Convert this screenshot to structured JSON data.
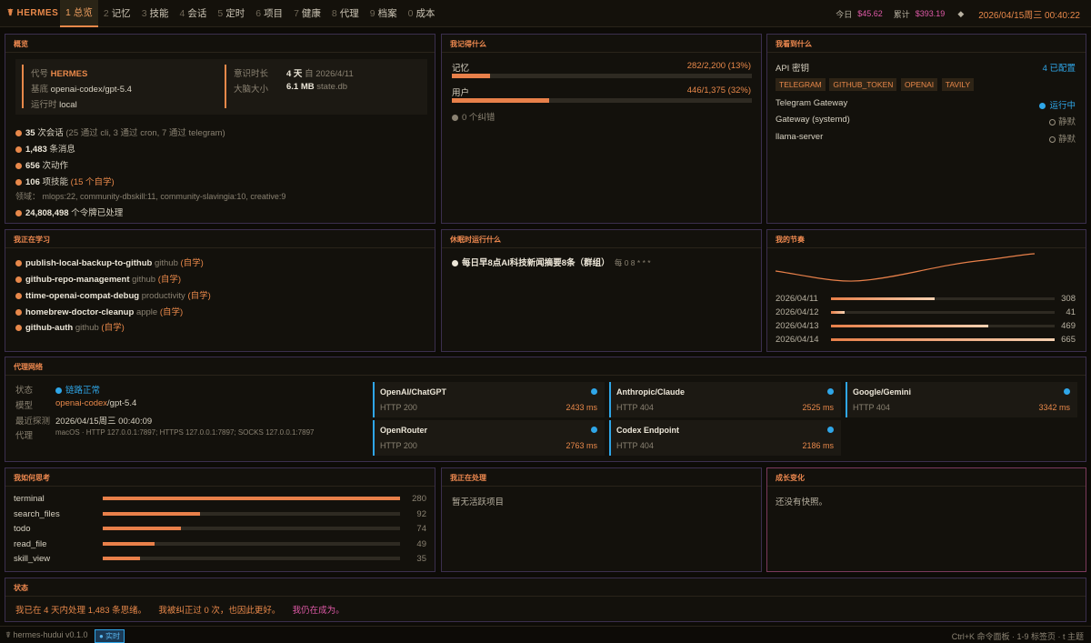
{
  "topbar": {
    "brand": "☤ HERMES",
    "tabs": [
      {
        "n": "1",
        "label": "总览"
      },
      {
        "n": "2",
        "label": "记忆"
      },
      {
        "n": "3",
        "label": "技能"
      },
      {
        "n": "4",
        "label": "会话"
      },
      {
        "n": "5",
        "label": "定时"
      },
      {
        "n": "6",
        "label": "项目"
      },
      {
        "n": "7",
        "label": "健康"
      },
      {
        "n": "8",
        "label": "代理"
      },
      {
        "n": "9",
        "label": "档案"
      },
      {
        "n": "0",
        "label": "成本"
      }
    ],
    "today_label": "今日",
    "today_value": "$45.62",
    "total_label": "累计",
    "total_value": "$393.19",
    "sep": "◆",
    "datetime": "2026/04/15周三 00:40:22"
  },
  "overview": {
    "title": "概览",
    "codename_label": "代号",
    "codename": "HERMES",
    "base_label": "基底",
    "base": "openai-codex/gpt-5.4",
    "runtime_label": "运行时",
    "runtime": "local",
    "awareness_label": "意识时长",
    "awareness_value": "4 天",
    "awareness_since": "自 2026/4/11",
    "brain_label": "大脑大小",
    "brain_value": "6.1 MB",
    "brain_file": "state.db",
    "sessions_value": "35",
    "sessions_text": "次会话",
    "sessions_detail": "(25 通过 cli, 3 通过 cron, 7 通过 telegram)",
    "messages_value": "1,483",
    "messages_text": "条消息",
    "actions_value": "656",
    "actions_text": "次动作",
    "skills_value": "106",
    "skills_text": "项技能",
    "skills_self": "(15 个自学)",
    "domains_text": "领域： mlops:22, community-dbskill:11, community-slavingia:10, creative:9",
    "tokens_value": "24,808,498",
    "tokens_text": "个令牌已处理"
  },
  "memory": {
    "title": "我记得什么",
    "mem_label": "记忆",
    "mem_value": "282/2,200 (13%)",
    "mem_fraction": 0.128,
    "user_label": "用户",
    "user_value": "446/1,375 (32%)",
    "user_fraction": 0.324,
    "corrections": "0 个纠错"
  },
  "sees": {
    "title": "我看到什么",
    "api_label": "API 密钥",
    "api_value": "4 已配置",
    "tags": [
      "TELEGRAM",
      "GITHUB_TOKEN",
      "OPENAI",
      "TAVILY"
    ],
    "services": [
      {
        "name": "Telegram Gateway",
        "status": "运行中",
        "on": true
      },
      {
        "name": "Gateway (systemd)",
        "status": "静默",
        "on": false
      },
      {
        "name": "llama-server",
        "status": "静默",
        "on": false
      }
    ]
  },
  "learning": {
    "title": "我正在学习",
    "items": [
      {
        "name": "publish-local-backup-to-github",
        "cat": "github",
        "tag": "(自学)"
      },
      {
        "name": "github-repo-management",
        "cat": "github",
        "tag": "(自学)"
      },
      {
        "name": "ttime-openai-compat-debug",
        "cat": "productivity",
        "tag": "(自学)"
      },
      {
        "name": "homebrew-doctor-cleanup",
        "cat": "apple",
        "tag": "(自学)"
      },
      {
        "name": "github-auth",
        "cat": "github",
        "tag": "(自学)"
      }
    ]
  },
  "sleep": {
    "title": "休眠时运行什么",
    "job": "每日早8点AI科技新闻摘要8条（群组）",
    "cron": "每 0 8 * * *"
  },
  "rhythm": {
    "title": "我的节奏",
    "days": [
      {
        "date": "2026/04/11",
        "value": 308
      },
      {
        "date": "2026/04/12",
        "value": 41
      },
      {
        "date": "2026/04/13",
        "value": 469
      },
      {
        "date": "2026/04/14",
        "value": 665
      }
    ]
  },
  "proxy": {
    "title": "代理网络",
    "status_label": "状态",
    "status_value": "链路正常",
    "model_label": "模型",
    "model_value_a": "openai-codex",
    "model_value_b": "/gpt-5.4",
    "probe_label": "最近探测",
    "probe_value": "2026/04/15周三 00:40:09",
    "proxy_label": "代理",
    "proxy_value": "macOS · HTTP 127.0.0.1:7897; HTTPS 127.0.0.1:7897; SOCKS 127.0.0.1:7897",
    "endpoints": [
      {
        "name": "OpenAI/ChatGPT",
        "status": "HTTP 200",
        "latency": "2433 ms"
      },
      {
        "name": "Anthropic/Claude",
        "status": "HTTP 404",
        "latency": "2525 ms"
      },
      {
        "name": "Google/Gemini",
        "status": "HTTP 404",
        "latency": "3342 ms"
      },
      {
        "name": "OpenRouter",
        "status": "HTTP 200",
        "latency": "2763 ms"
      },
      {
        "name": "Codex Endpoint",
        "status": "HTTP 404",
        "latency": "2186 ms"
      }
    ]
  },
  "thinking": {
    "title": "我如何思考",
    "max": 280,
    "tools": [
      {
        "name": "terminal",
        "value": 280
      },
      {
        "name": "search_files",
        "value": 92
      },
      {
        "name": "todo",
        "value": 74
      },
      {
        "name": "read_file",
        "value": 49
      },
      {
        "name": "skill_view",
        "value": 35
      }
    ]
  },
  "processing": {
    "title": "我正在处理",
    "text": "暂无活跃项目"
  },
  "growth": {
    "title": "成长变化",
    "text": "还没有快照。"
  },
  "state": {
    "title": "状态",
    "line1": "我已在 4 天内处理 1,483 条思绪。",
    "line2": "我被纠正过 0 次，也因此更好。",
    "line3": "我仍在成为。"
  },
  "footer": {
    "version": "☤ hermes-hudui v0.1.0",
    "live": "● 实时",
    "hint": "Ctrl+K 命令面板 · 1-9 标签页 · t 主题"
  }
}
